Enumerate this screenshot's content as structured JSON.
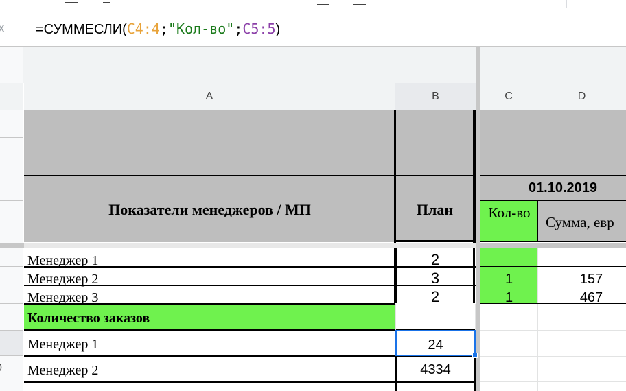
{
  "formula_bar": {
    "fx_label": "x",
    "parts": [
      {
        "text": "=СУММЕСЛИ(",
        "color": "#000000"
      },
      {
        "text": "C4:4",
        "color": "#e8a33a"
      },
      {
        "text": ";",
        "color": "#000000"
      },
      {
        "text": "\"Кол-во\"",
        "color": "#1a7a1a"
      },
      {
        "text": ";",
        "color": "#000000"
      },
      {
        "text": "C5:5",
        "color": "#8b3fa8"
      },
      {
        "text": ")",
        "color": "#000000"
      }
    ]
  },
  "columns": [
    "A",
    "B",
    "C",
    "D"
  ],
  "header": {
    "title": "Показатели менеджеров / МП",
    "plan": "План",
    "date": "01.10.2019",
    "qty": "Кол-во",
    "sum": "Сумма, евр"
  },
  "rows": [
    {
      "name": "Менеджер 1",
      "plan": "2",
      "qty": "",
      "sum": ""
    },
    {
      "name": "Менеджер 2",
      "plan": "3",
      "qty": "1",
      "sum": "157"
    },
    {
      "name": "Менеджер 3",
      "plan": "2",
      "qty": "1",
      "sum": "467"
    }
  ],
  "section": {
    "title": "Количество заказов"
  },
  "orders": [
    {
      "name": "Менеджер 1",
      "plan": "24"
    },
    {
      "name": "Менеджер 2",
      "plan": "4334"
    }
  ],
  "row_number_partial": "0",
  "colors": {
    "accent_green": "#6ff24e",
    "header_gray": "#bebebe",
    "selection_blue": "#1a73e8"
  }
}
